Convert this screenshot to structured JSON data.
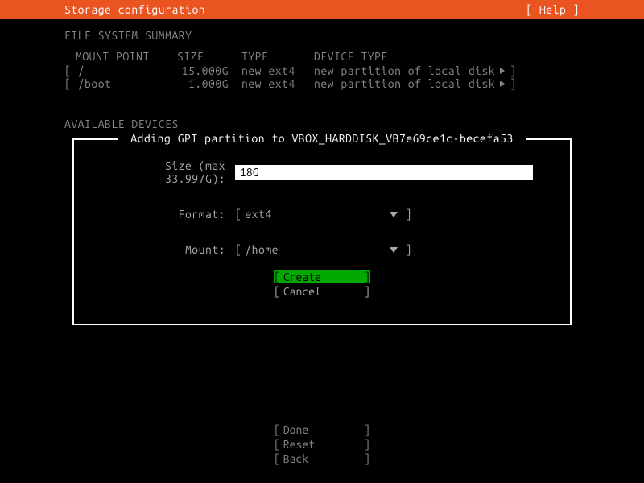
{
  "header": {
    "title": "Storage configuration",
    "help": "[ Help ]"
  },
  "summary": {
    "title": "FILE SYSTEM SUMMARY",
    "columns": {
      "mount": "MOUNT POINT",
      "size": "SIZE",
      "type": "TYPE",
      "device": "DEVICE TYPE"
    },
    "rows": [
      {
        "mount": "/",
        "size": "15.000G",
        "type": "new ext4",
        "device": "new partition of local disk"
      },
      {
        "mount": "/boot",
        "size": "1.000G",
        "type": "new ext4",
        "device": "new partition of local disk"
      }
    ]
  },
  "available": {
    "title": "AVAILABLE DEVICES"
  },
  "dialog": {
    "title": "Adding GPT partition to VBOX_HARDDISK_VB7e69ce1c-becefa53",
    "size_label": "Size (max 33.997G):",
    "size_value": "18G",
    "format_label": "Format:",
    "format_value": "ext4",
    "mount_label": "Mount:",
    "mount_value": "/home",
    "create": "Create",
    "cancel": "Cancel"
  },
  "footer": {
    "done": "Done",
    "reset": "Reset",
    "back": "Back"
  },
  "brackets": {
    "l": "[",
    "r": "]"
  }
}
